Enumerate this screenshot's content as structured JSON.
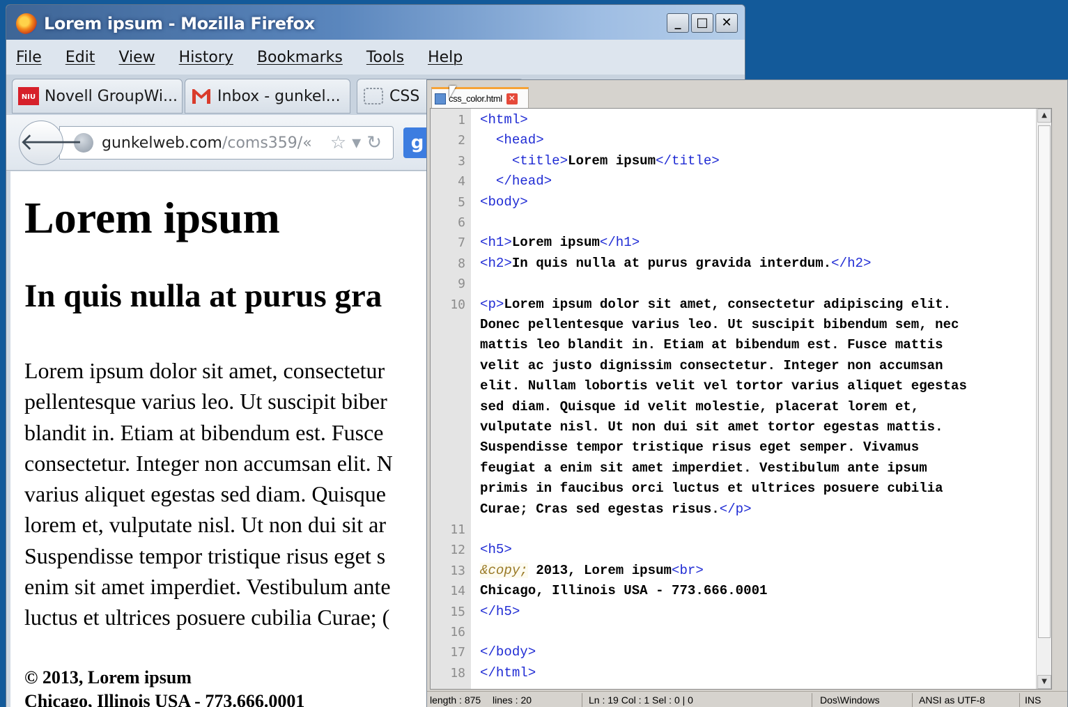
{
  "firefox": {
    "title": "Lorem ipsum - Mozilla Firefox",
    "window_buttons": [
      "_",
      "□",
      "✕"
    ],
    "menu": [
      "File",
      "Edit",
      "View",
      "History",
      "Bookmarks",
      "Tools",
      "Help"
    ],
    "tabs": [
      {
        "label": "Novell GroupWi...",
        "icon": "groupwise-icon"
      },
      {
        "label": "Inbox - gunkel...",
        "icon": "gmail-icon"
      },
      {
        "label": "CSS",
        "icon": "dotted-square-icon"
      }
    ],
    "url_host": "gunkelweb.com",
    "url_path": "/coms359/«",
    "search_engine_letter": "g",
    "page": {
      "h1": "Lorem ipsum",
      "h2": "In quis nulla at purus gra",
      "paragraph_lines": [
        "Lorem ipsum dolor sit amet, consectetur",
        "pellentesque varius leo. Ut suscipit biber",
        "blandit in. Etiam at bibendum est. Fusce",
        "consectetur. Integer non accumsan elit. N",
        "varius aliquet egestas sed diam. Quisque",
        "lorem et, vulputate nisl. Ut non dui sit ar",
        "Suspendisse tempor tristique risus eget s",
        "enim sit amet imperdiet. Vestibulum ante",
        "luctus et ultrices posuere cubilia Curae; ("
      ],
      "footer_lines": [
        "© 2013, Lorem ipsum",
        "Chicago, Illinois USA - 773.666.0001"
      ]
    }
  },
  "notepad": {
    "tab_label": "css_color.html",
    "tab_close": "✕",
    "lines": [
      {
        "n": "1",
        "segs": [
          {
            "t": "<html>",
            "c": "tag"
          }
        ]
      },
      {
        "n": "2",
        "segs": [
          {
            "t": "  <head>",
            "c": "tag"
          }
        ]
      },
      {
        "n": "3",
        "segs": [
          {
            "t": "    <title>",
            "c": "tag"
          },
          {
            "t": "Lorem ipsum",
            "c": "txt"
          },
          {
            "t": "</title>",
            "c": "tag"
          }
        ]
      },
      {
        "n": "4",
        "segs": [
          {
            "t": "  </head>",
            "c": "tag"
          }
        ]
      },
      {
        "n": "5",
        "segs": [
          {
            "t": "<body>",
            "c": "tag"
          }
        ]
      },
      {
        "n": "6",
        "segs": []
      },
      {
        "n": "7",
        "segs": [
          {
            "t": "<h1>",
            "c": "tag"
          },
          {
            "t": "Lorem ipsum",
            "c": "txt"
          },
          {
            "t": "</h1>",
            "c": "tag"
          }
        ]
      },
      {
        "n": "8",
        "segs": [
          {
            "t": "<h2>",
            "c": "tag"
          },
          {
            "t": "In quis nulla at purus gravida interdum.",
            "c": "txt"
          },
          {
            "t": "</h2>",
            "c": "tag"
          }
        ]
      },
      {
        "n": "9",
        "segs": []
      },
      {
        "n": "10",
        "segs": [
          {
            "t": "<p>",
            "c": "tag"
          },
          {
            "t": "Lorem ipsum dolor sit amet, consectetur adipiscing elit.",
            "c": "txt"
          }
        ]
      },
      {
        "n": "",
        "segs": [
          {
            "t": "Donec pellentesque varius leo. Ut suscipit bibendum sem, nec",
            "c": "txt"
          }
        ]
      },
      {
        "n": "",
        "segs": [
          {
            "t": "mattis leo blandit in. Etiam at bibendum est. Fusce mattis",
            "c": "txt"
          }
        ]
      },
      {
        "n": "",
        "segs": [
          {
            "t": "velit ac justo dignissim consectetur. Integer non accumsan",
            "c": "txt"
          }
        ]
      },
      {
        "n": "",
        "segs": [
          {
            "t": "elit. Nullam lobortis velit vel tortor varius aliquet egestas",
            "c": "txt"
          }
        ]
      },
      {
        "n": "",
        "segs": [
          {
            "t": "sed diam. Quisque id velit molestie, placerat lorem et,",
            "c": "txt"
          }
        ]
      },
      {
        "n": "",
        "segs": [
          {
            "t": "vulputate nisl. Ut non dui sit amet tortor egestas mattis.",
            "c": "txt"
          }
        ]
      },
      {
        "n": "",
        "segs": [
          {
            "t": "Suspendisse tempor tristique risus eget semper. Vivamus",
            "c": "txt"
          }
        ]
      },
      {
        "n": "",
        "segs": [
          {
            "t": "feugiat a enim sit amet imperdiet. Vestibulum ante ipsum",
            "c": "txt"
          }
        ]
      },
      {
        "n": "",
        "segs": [
          {
            "t": "primis in faucibus orci luctus et ultrices posuere cubilia",
            "c": "txt"
          }
        ]
      },
      {
        "n": "",
        "segs": [
          {
            "t": "Curae; Cras sed egestas risus.",
            "c": "txt"
          },
          {
            "t": "</p>",
            "c": "tag"
          }
        ]
      },
      {
        "n": "11",
        "segs": []
      },
      {
        "n": "12",
        "segs": [
          {
            "t": "<h5>",
            "c": "tag"
          }
        ]
      },
      {
        "n": "13",
        "segs": [
          {
            "t": "&copy;",
            "c": "ent"
          },
          {
            "t": " 2013, Lorem ipsum",
            "c": "txt"
          },
          {
            "t": "<br>",
            "c": "tag"
          }
        ]
      },
      {
        "n": "14",
        "segs": [
          {
            "t": "Chicago, Illinois USA - 773.666.0001",
            "c": "txt"
          }
        ]
      },
      {
        "n": "15",
        "segs": [
          {
            "t": "</h5>",
            "c": "tag"
          }
        ]
      },
      {
        "n": "16",
        "segs": []
      },
      {
        "n": "17",
        "segs": [
          {
            "t": "</body>",
            "c": "tag"
          }
        ]
      },
      {
        "n": "18",
        "segs": [
          {
            "t": "</html>",
            "c": "tag"
          }
        ]
      }
    ],
    "status": {
      "length": "length : 875",
      "lines": "lines : 20",
      "position": "Ln : 19    Col : 1    Sel : 0 | 0",
      "eol": "Dos\\Windows",
      "encoding": "ANSI as UTF-8",
      "mode": "INS"
    },
    "colors": {
      "tag": "#1f2bd4",
      "text": "#000000",
      "entity": "#9a7a26",
      "gutter": "#e4e4e4"
    }
  }
}
